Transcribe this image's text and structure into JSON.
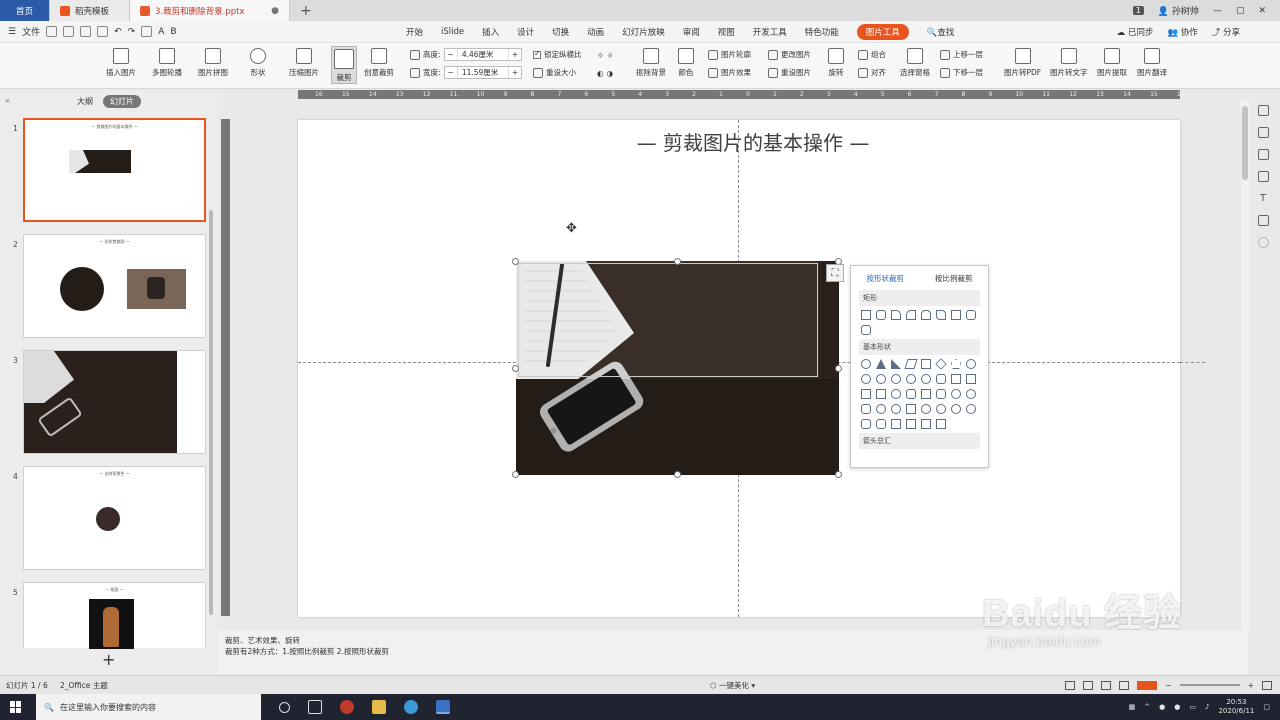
{
  "tabs": {
    "home": "首页",
    "template": "稻壳模板",
    "document": "3.裁剪和删除背景.pptx",
    "add": "+",
    "page_badge": "1",
    "user": "孙树帅"
  },
  "menubar": {
    "file": "文件",
    "items": [
      "开始",
      "iSlide",
      "插入",
      "设计",
      "切换",
      "动画",
      "幻灯片放映",
      "审阅",
      "视图",
      "开发工具",
      "特色功能",
      "图片工具",
      "查找"
    ],
    "active": "图片工具",
    "sync": "已同步",
    "collab": "协作",
    "share": "分享"
  },
  "ribbon": {
    "insert_pic": "插入图片",
    "multi_pic": "多图轮播",
    "pic_mosaic": "图片拼图",
    "shape": "形状",
    "compress": "压缩图片",
    "crop": "裁剪",
    "creative_crop": "创意裁剪",
    "height_label": "高度:",
    "height_value": "4.46厘米",
    "width_label": "宽度:",
    "width_value": "11.59厘米",
    "lock_ratio": "锁定纵横比",
    "reset_size": "重设大小",
    "remove_bg": "抠除背景",
    "color": "颜色",
    "pic_outline": "图片轮廓",
    "pic_effect": "图片效果",
    "change_pic": "更改图片",
    "reset_pic": "重设图片",
    "rotate": "旋转",
    "group": "组合",
    "align": "对齐",
    "selection_pane": "选择窗格",
    "bring_forward": "上移一层",
    "send_backward": "下移一层",
    "to_pdf": "图片转PDF",
    "to_text": "图片转文字",
    "extract": "图片提取",
    "translate": "图片翻译"
  },
  "ruler_ticks": [
    "16",
    "15",
    "14",
    "13",
    "12",
    "11",
    "10",
    "9",
    "8",
    "7",
    "6",
    "5",
    "4",
    "3",
    "2",
    "1",
    "0",
    "1",
    "2",
    "3",
    "4",
    "5",
    "6",
    "7",
    "8",
    "9",
    "10",
    "11",
    "12",
    "13",
    "14",
    "15",
    "16"
  ],
  "sidepanel": {
    "outline_tab": "大纲",
    "slides_tab": "幻灯片",
    "collapse": "«",
    "add": "+",
    "slides": [
      {
        "num": "1",
        "title": "— 剪裁图片的基本操作 —"
      },
      {
        "num": "2",
        "title": "— 形状剪裁图 —"
      },
      {
        "num": "3",
        "title": ""
      },
      {
        "num": "4",
        "title": "— 去除背景色 —"
      },
      {
        "num": "5",
        "title": "— 抠图 —"
      }
    ]
  },
  "slide": {
    "title": "— 剪裁图片的基本操作 —"
  },
  "crop_popup": {
    "tab_shape": "按形状裁剪",
    "tab_ratio": "按比例裁剪",
    "sec_rect": "矩形",
    "sec_basic": "基本形状",
    "sec_arrow": "箭头总汇"
  },
  "notes": {
    "line1": "裁剪、艺术效果、旋转",
    "line2": "裁剪有2种方式：1.按照比例裁剪 2.按照形状裁剪"
  },
  "status": {
    "slide_count": "幻灯片 1 / 6",
    "theme": "2_Office 主题",
    "beautify": "一键美化"
  },
  "taskbar": {
    "search_placeholder": "在这里输入你要搜索的内容",
    "time": "20:53",
    "date": "2020/6/11"
  },
  "watermark": {
    "logo": "Baidu 经验",
    "url": "jingyan.baidu.com"
  },
  "colors": {
    "accent": "#e8541e",
    "tab_home": "#2b5aa8",
    "popup_active": "#2b6cc4",
    "taskbar": "#1f2430"
  }
}
